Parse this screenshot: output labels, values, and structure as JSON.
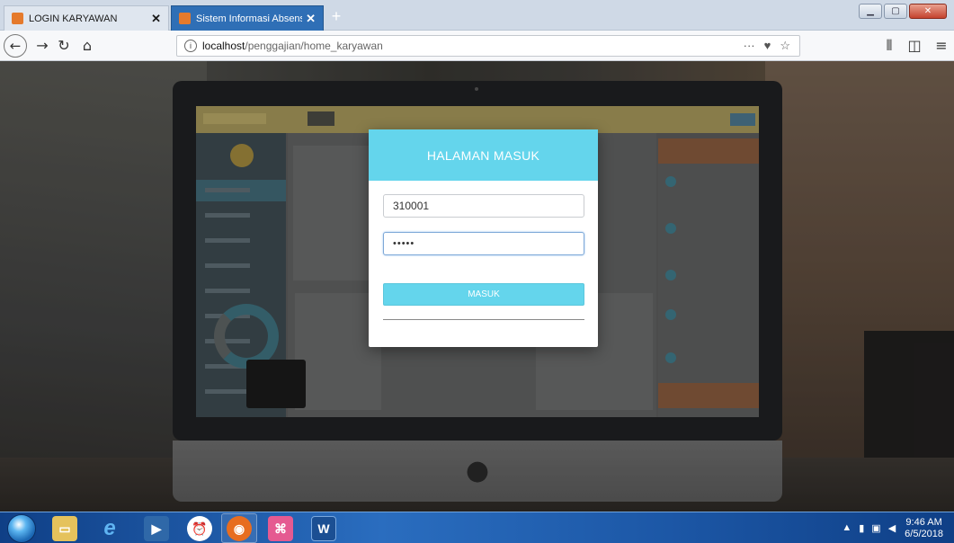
{
  "browser": {
    "tabs": [
      {
        "label": "LOGIN KARYAWAN",
        "active": false
      },
      {
        "label": "Sistem Informasi Absensi & Pe",
        "active": true
      }
    ],
    "new_tab_symbol": "+",
    "url_host": "localhost",
    "url_path": "/penggajian/home_karyawan",
    "url_info_icon": "i",
    "url_actions": [
      "···",
      "♥",
      "☆"
    ],
    "nav_icons": [
      "back-icon",
      "forward-icon",
      "reload-icon",
      "home-icon"
    ],
    "right_icons": [
      "library-icon",
      "sidebar-icon",
      "menu-icon"
    ]
  },
  "login": {
    "title": "HALAMAN MASUK",
    "username_value": "310001",
    "password_value": "•••••",
    "submit_label": "MASUK"
  },
  "taskbar": {
    "icons": [
      "start-icon",
      "file-explorer-icon",
      "internet-explorer-icon",
      "media-player-icon",
      "alarm-icon",
      "firefox-icon",
      "app-icon",
      "word-icon"
    ],
    "word_label": "W",
    "clock_time": "9:46 AM",
    "clock_date": "6/5/2018"
  },
  "colors": {
    "accent": "#64d5ec",
    "taskbar": "#2a6dbf",
    "active_tab": "#2f6fb6"
  }
}
